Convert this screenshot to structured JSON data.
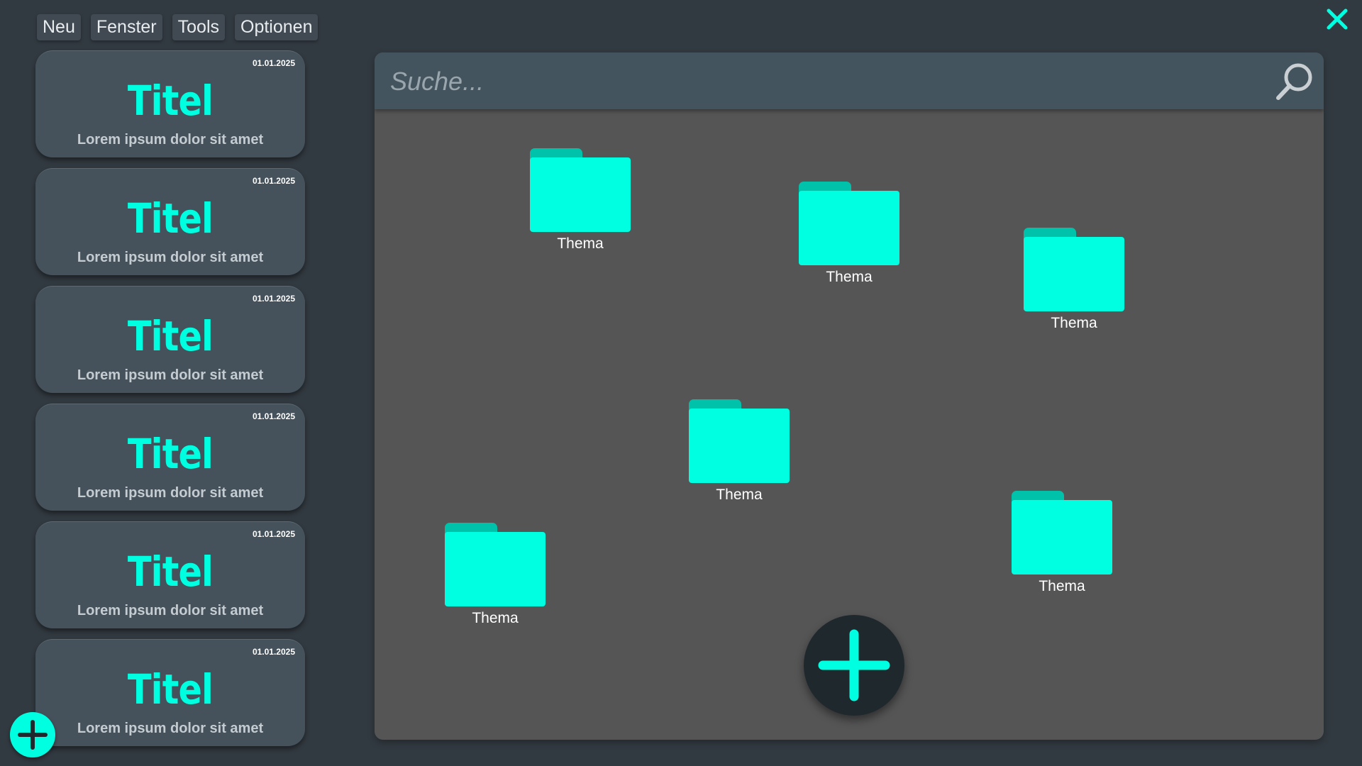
{
  "menu": {
    "items": [
      {
        "label": "Neu"
      },
      {
        "label": "Fenster"
      },
      {
        "label": "Tools"
      },
      {
        "label": "Optionen"
      }
    ]
  },
  "close": {
    "icon": "close-icon"
  },
  "colors": {
    "accent": "#00ffe0",
    "background": "#323a41",
    "card": "#45525b",
    "panel": "#555556",
    "searchbar": "#44545e"
  },
  "sidebar": {
    "cards": [
      {
        "date": "01.01.2025",
        "title": "Titel",
        "subtitle": "Lorem ipsum dolor sit amet"
      },
      {
        "date": "01.01.2025",
        "title": "Titel",
        "subtitle": "Lorem ipsum dolor sit amet"
      },
      {
        "date": "01.01.2025",
        "title": "Titel",
        "subtitle": "Lorem ipsum dolor sit amet"
      },
      {
        "date": "01.01.2025",
        "title": "Titel",
        "subtitle": "Lorem ipsum dolor sit amet"
      },
      {
        "date": "01.01.2025",
        "title": "Titel",
        "subtitle": "Lorem ipsum dolor sit amet"
      },
      {
        "date": "01.01.2025",
        "title": "Titel",
        "subtitle": "Lorem ipsum dolor sit amet"
      }
    ],
    "add_icon": "plus-icon"
  },
  "search": {
    "placeholder": "Suche...",
    "value": "",
    "icon": "search-icon"
  },
  "folders": [
    {
      "label": "Thema",
      "icon": "folder-icon"
    },
    {
      "label": "Thema",
      "icon": "folder-icon"
    },
    {
      "label": "Thema",
      "icon": "folder-icon"
    },
    {
      "label": "Thema",
      "icon": "folder-icon"
    },
    {
      "label": "Thema",
      "icon": "folder-icon"
    },
    {
      "label": "Thema",
      "icon": "folder-icon"
    }
  ],
  "main_add": {
    "icon": "plus-icon"
  }
}
